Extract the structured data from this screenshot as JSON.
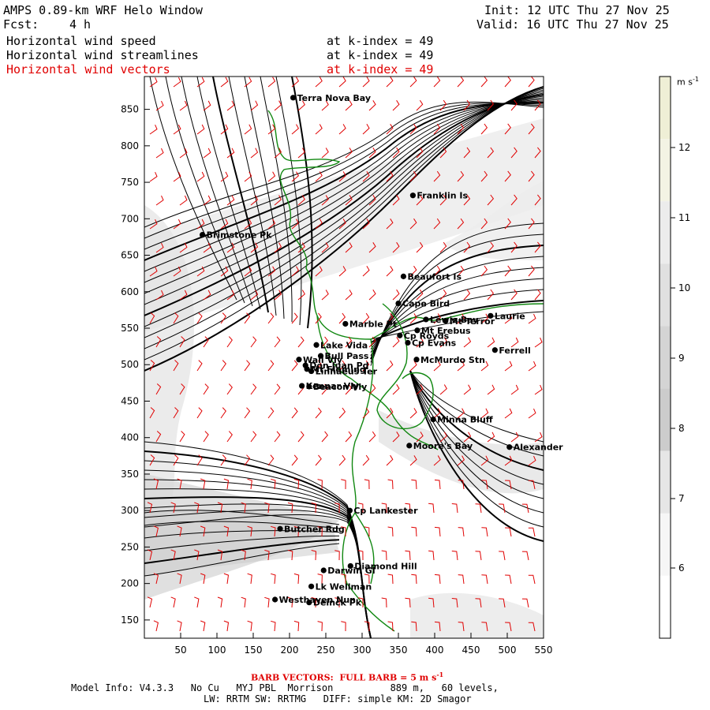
{
  "header": {
    "title": "AMPS 0.89-km WRF Helo Window",
    "fcst_label": "Fcst:",
    "fcst_value": "4 h",
    "init": "Init: 12 UTC Thu 27 Nov 25",
    "valid": "Valid: 16 UTC Thu 27 Nov 25",
    "fields": [
      {
        "name": "Horizontal wind speed",
        "level": "at k-index = 49"
      },
      {
        "name": "Horizontal wind streamlines",
        "level": "at k-index = 49"
      },
      {
        "name": "Horizontal wind vectors",
        "level": "at k-index = 49"
      }
    ]
  },
  "axes": {
    "x_ticks": [
      "50",
      "100",
      "150",
      "200",
      "250",
      "300",
      "350",
      "400",
      "450",
      "500",
      "550"
    ],
    "y_ticks": [
      "850",
      "800",
      "750",
      "700",
      "650",
      "600",
      "550",
      "500",
      "450",
      "400",
      "350",
      "300",
      "250",
      "200",
      "150"
    ]
  },
  "colorbar": {
    "unit": "m s",
    "unit_sup": "-1",
    "ticks": [
      "12",
      "11",
      "10",
      "9",
      "8",
      "7",
      "6"
    ],
    "colors": [
      "#efefd6",
      "#f3f3e4",
      "#ececec",
      "#e0e0e0",
      "#d4d4d4",
      "#cccccc",
      "#e6e6e6",
      "#f6f6f6",
      "#ffffff"
    ]
  },
  "places": [
    {
      "name": "Terra Nova Bay",
      "x": 205,
      "y": 866
    },
    {
      "name": "Brimstone Pk",
      "x": 80,
      "y": 678
    },
    {
      "name": "Franklin Is",
      "x": 370,
      "y": 732
    },
    {
      "name": "Beaufort Is",
      "x": 357,
      "y": 621
    },
    {
      "name": "Cape Bird",
      "x": 350,
      "y": 584
    },
    {
      "name": "Lewis Bay",
      "x": 388,
      "y": 562
    },
    {
      "name": "Mt Terror",
      "x": 415,
      "y": 560
    },
    {
      "name": "Laurie",
      "x": 477,
      "y": 567
    },
    {
      "name": "Marble Pt",
      "x": 277,
      "y": 556
    },
    {
      "name": "Cp Royds",
      "x": 352,
      "y": 540
    },
    {
      "name": "Mt Erebus",
      "x": 376,
      "y": 547
    },
    {
      "name": "Cp Evans",
      "x": 363,
      "y": 530
    },
    {
      "name": "Ferrell",
      "x": 483,
      "y": 520
    },
    {
      "name": "Lake Vida",
      "x": 237,
      "y": 527
    },
    {
      "name": "Wall Vly",
      "x": 213,
      "y": 507
    },
    {
      "name": "Bull Pass",
      "x": 243,
      "y": 512
    },
    {
      "name": "Don Juan Pd",
      "x": 222,
      "y": 499
    },
    {
      "name": "McMurdo Stn",
      "x": 375,
      "y": 507
    },
    {
      "name": "Mt Fleming",
      "x": 224,
      "y": 494
    },
    {
      "name": "Linnaeus Ter",
      "x": 230,
      "y": 491
    },
    {
      "name": "Kennar Vly",
      "x": 217,
      "y": 471
    },
    {
      "name": "Beacon Vly",
      "x": 227,
      "y": 470
    },
    {
      "name": "Minna Bluff",
      "x": 398,
      "y": 425
    },
    {
      "name": "Moore's Bay",
      "x": 365,
      "y": 389
    },
    {
      "name": "Alexander",
      "x": 503,
      "y": 387
    },
    {
      "name": "Cp Lankester",
      "x": 283,
      "y": 300
    },
    {
      "name": "Butcher Rdg",
      "x": 187,
      "y": 275
    },
    {
      "name": "Diamond Hill",
      "x": 284,
      "y": 224
    },
    {
      "name": "Darwin Gl",
      "x": 247,
      "y": 218
    },
    {
      "name": "Lk Wellman",
      "x": 230,
      "y": 196
    },
    {
      "name": "Westhaven Nun",
      "x": 180,
      "y": 178
    },
    {
      "name": "Deinck Pk",
      "x": 227,
      "y": 174
    }
  ],
  "barb_note": "BARB VECTORS:  FULL BARB = 5 m s",
  "barb_note_sup": "-1",
  "footer": {
    "model_info": "Model Info: V4.3.3   No Cu   MYJ PBL  Morrison          889 m,   60 levels,",
    "physics": "LW: RRTM SW: RRTMG   DIFF: simple KM: 2D Smagor"
  }
}
